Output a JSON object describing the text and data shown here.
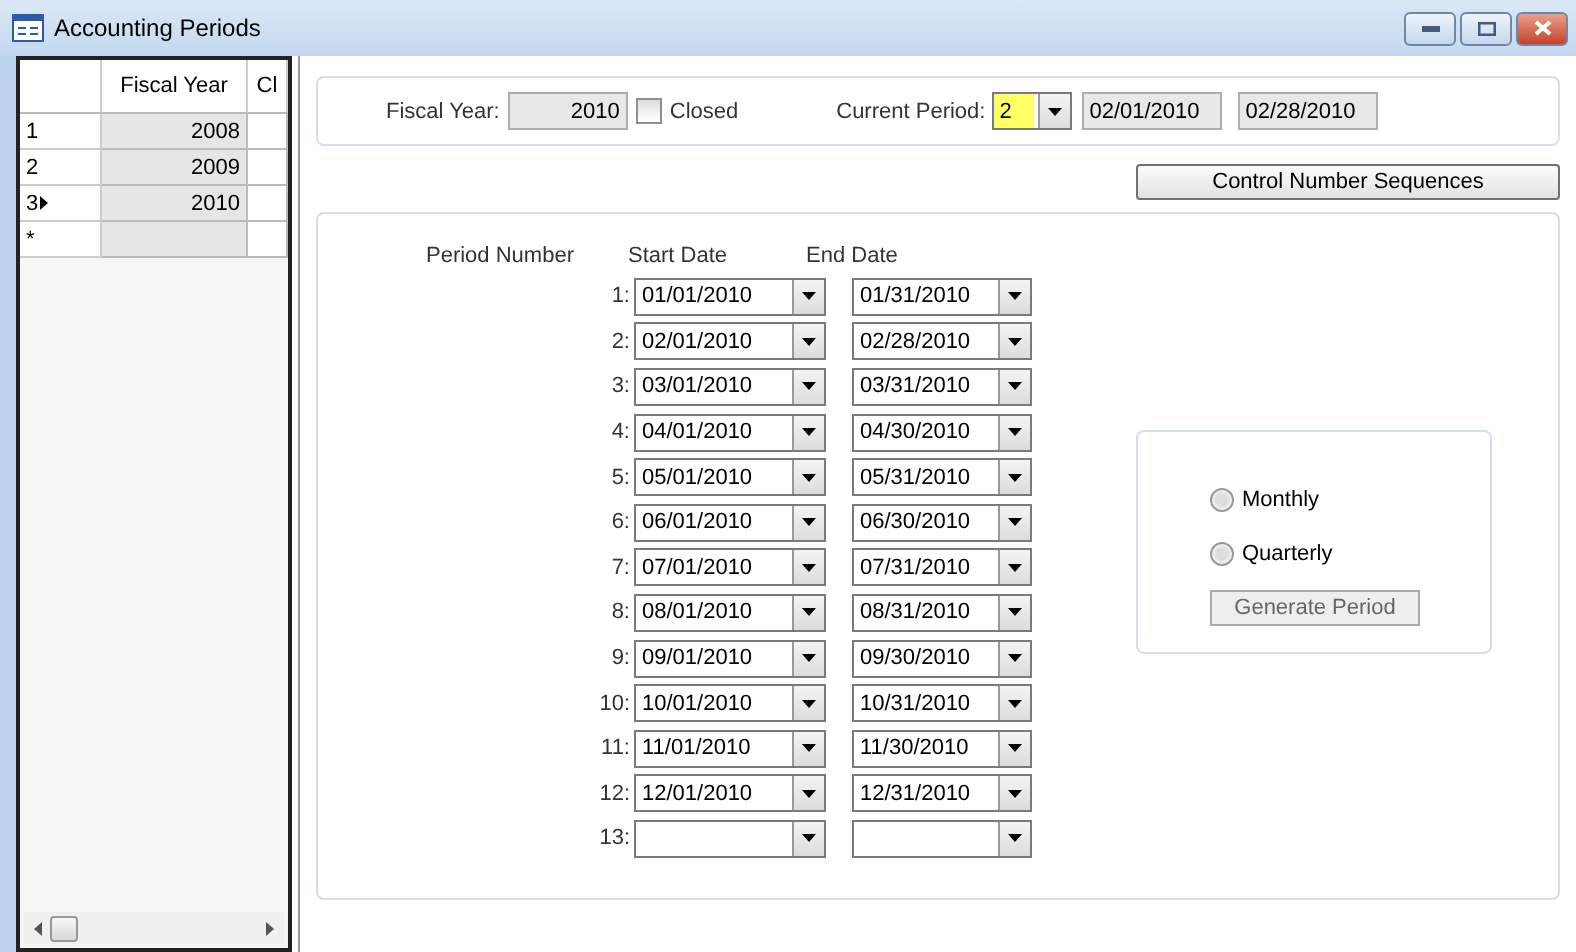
{
  "window": {
    "title": "Accounting Periods"
  },
  "grid": {
    "columns": [
      "Fiscal Year",
      "Cl"
    ],
    "rows": [
      {
        "kind": "data",
        "header": "1",
        "fiscal_year": "2008",
        "current": false
      },
      {
        "kind": "data",
        "header": "2",
        "fiscal_year": "2009",
        "current": false
      },
      {
        "kind": "data",
        "header": "3",
        "fiscal_year": "2010",
        "current": true
      },
      {
        "kind": "new",
        "header": "*"
      }
    ]
  },
  "header": {
    "fiscal_year_label": "Fiscal Year:",
    "fiscal_year": "2010",
    "closed_label": "Closed",
    "closed_checked": false,
    "current_period_label": "Current Period:",
    "current_period": "2",
    "current_period_highlighted": true,
    "period_start": "02/01/2010",
    "period_end": "02/28/2010"
  },
  "control_button": "Control Number Sequences",
  "periods": {
    "columns": [
      "Period Number",
      "Start Date",
      "End Date"
    ],
    "rows": [
      {
        "number": "1:",
        "start": "01/01/2010",
        "end": "01/31/2010"
      },
      {
        "number": "2:",
        "start": "02/01/2010",
        "end": "02/28/2010"
      },
      {
        "number": "3:",
        "start": "03/01/2010",
        "end": "03/31/2010"
      },
      {
        "number": "4:",
        "start": "04/01/2010",
        "end": "04/30/2010"
      },
      {
        "number": "5:",
        "start": "05/01/2010",
        "end": "05/31/2010"
      },
      {
        "number": "6:",
        "start": "06/01/2010",
        "end": "06/30/2010"
      },
      {
        "number": "7:",
        "start": "07/01/2010",
        "end": "07/31/2010"
      },
      {
        "number": "8:",
        "start": "08/01/2010",
        "end": "08/31/2010"
      },
      {
        "number": "9:",
        "start": "09/01/2010",
        "end": "09/30/2010"
      },
      {
        "number": "10:",
        "start": "10/01/2010",
        "end": "10/31/2010"
      },
      {
        "number": "11:",
        "start": "11/01/2010",
        "end": "11/30/2010"
      },
      {
        "number": "12:",
        "start": "12/01/2010",
        "end": "12/31/2010"
      },
      {
        "number": "13:"
      }
    ]
  },
  "generate": {
    "options": [
      {
        "label": "Monthly",
        "selected": false
      },
      {
        "label": "Quarterly",
        "selected": false
      }
    ],
    "button": "Generate Period",
    "button_disabled": true
  }
}
